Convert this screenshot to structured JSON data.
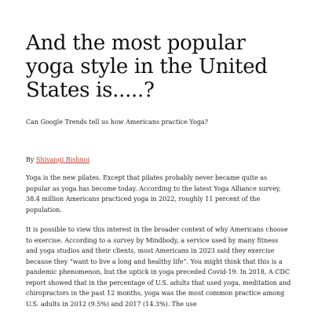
{
  "article": {
    "title": "And the most popular yoga style in the United States is.....?",
    "subtitle": "Can Google Trends tell us how Americans practice Yoga?",
    "byline_prefix": "By",
    "author": "Shivangi Bishnoi",
    "paragraphs": [
      "Yoga is the new pilates. Except that pilates probably never became quite as popular as yoga has become today. According to the latest Yoga Alliance survey, 38.4 million Americans practiced yoga in 2022, roughly 11 percent of the population.",
      "It is possible to view this interest in the broader context of why Americans choose to exercise. According to a survey by Mindbody, a service used by many fitness and yoga studios and their clients, most Americans in 2023 said they exercise because they “want to live a long and healthy life”. You might think that this is a pandemic phenomenon, but the uptick in yoga preceded Covid-19. In 2018, A CDC report showed that in the percentage of U.S. adults that used yoga, meditation and chiropractors in the past 12 months, yoga was the most common practice among U.S. adults in 2012 (9.5%) and 2017 (14.3%). The use"
    ]
  }
}
